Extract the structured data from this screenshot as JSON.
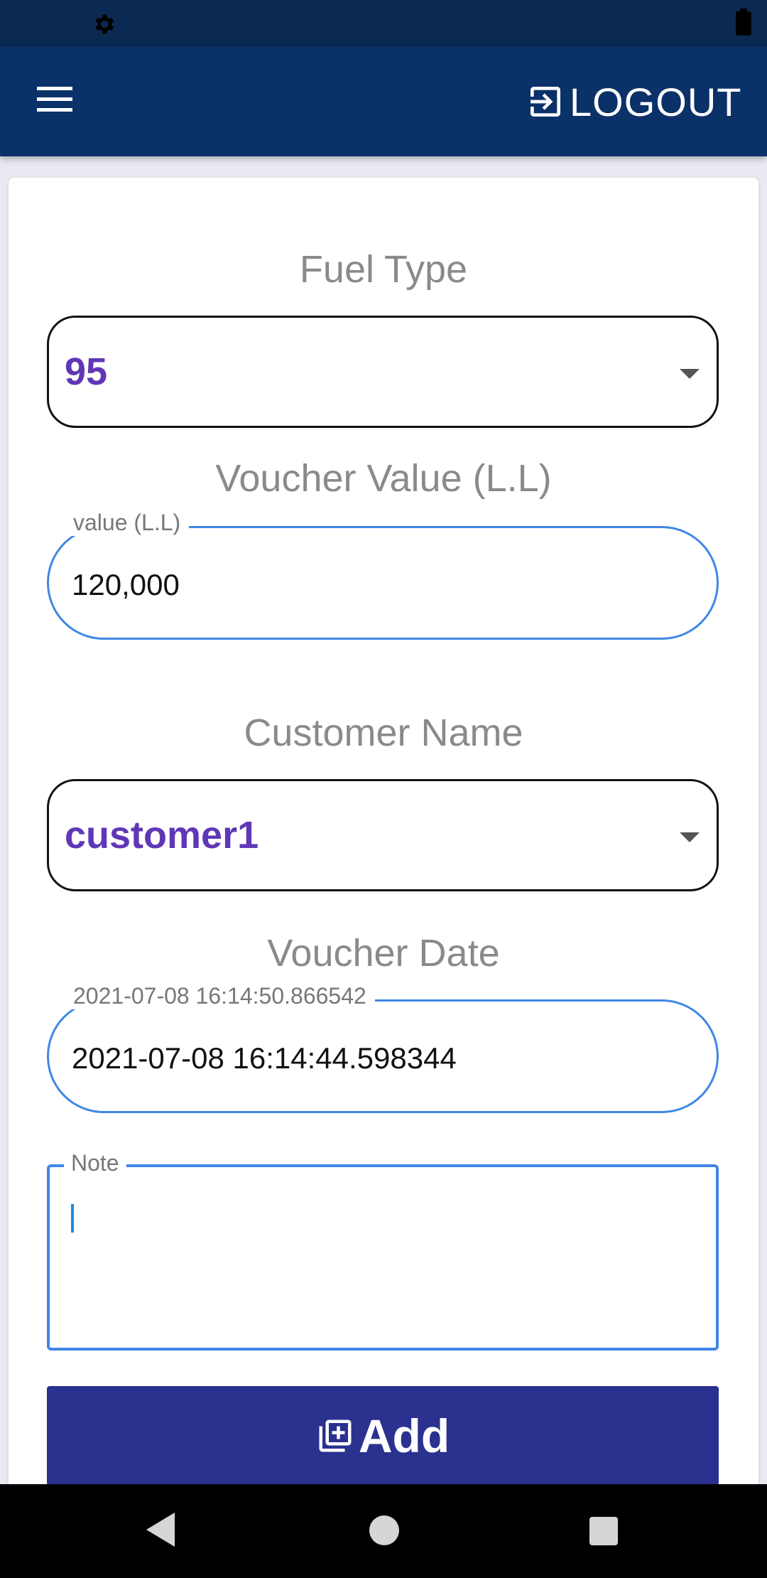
{
  "header": {
    "menu_icon": "hamburger-menu-icon",
    "logout_icon": "login-arrow-box-icon",
    "logout_label": "LOGOUT",
    "background_color": "#0b3169"
  },
  "status_bar": {
    "settings_icon": "gear-icon",
    "battery_icon": "battery-icon"
  },
  "form": {
    "fuel_type": {
      "heading": "Fuel Type",
      "selected_value": "95"
    },
    "voucher_value": {
      "heading": "Voucher Value (L.L)",
      "label": "value (L.L)",
      "value": "120,000"
    },
    "customer": {
      "heading": "Customer Name",
      "selected_value": "customer1"
    },
    "voucher_date": {
      "heading": "Voucher Date",
      "label": "2021-07-08 16:14:50.866542",
      "value": "2021-07-08 16:14:44.598344"
    },
    "note": {
      "label": "Note",
      "value": ""
    },
    "add_button": {
      "label": "Add",
      "icon": "library-add-icon",
      "color": "#2a318f"
    },
    "accent_color": "#3f87e6",
    "selected_color": "#5f37b6"
  },
  "nav_bar": {
    "back_icon": "back-triangle-icon",
    "home_icon": "home-circle-icon",
    "recents_icon": "recents-square-icon"
  }
}
